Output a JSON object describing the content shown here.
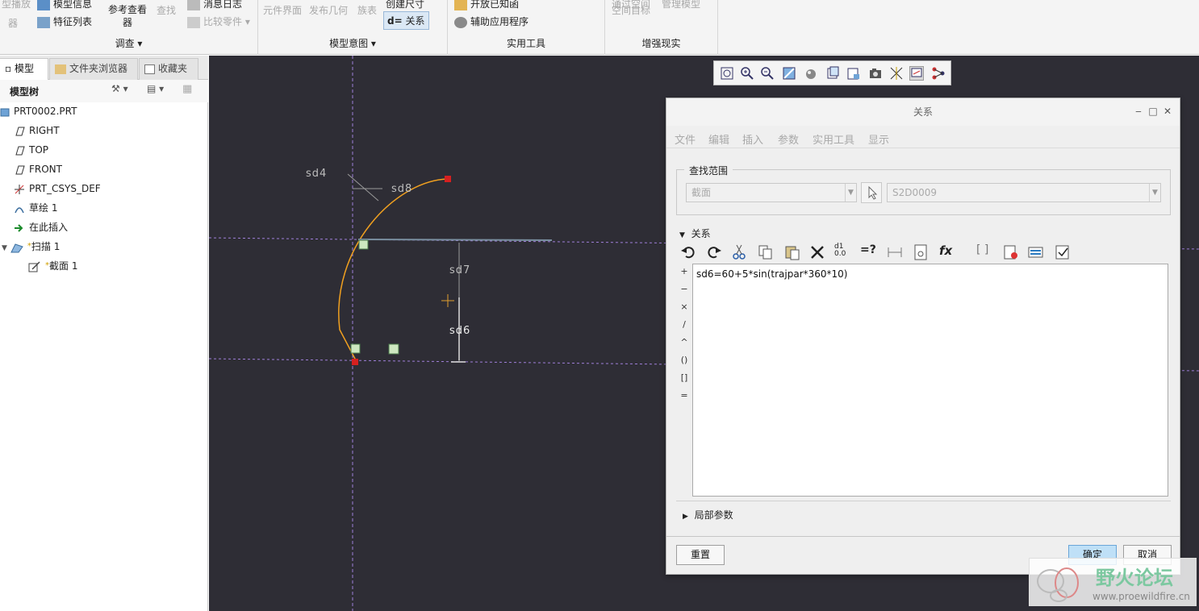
{
  "ribbon": {
    "row_top": {
      "g1": "型播放",
      "g2": "模型信息",
      "g4": "消息日志",
      "g5": "创建尺寸",
      "g6": "开放已知函",
      "g7": "通过空间",
      "g8": "管理模型"
    },
    "group1": {
      "item_a": "器",
      "item_b": "特征列表",
      "item_c": "参考查看",
      "item_c2": "器",
      "item_d": "查找",
      "item_e": "比较零件",
      "label": "调查"
    },
    "group2": {
      "item_a": "元件界面",
      "item_b": "发布几何",
      "item_c": "族表",
      "item_d": "关系",
      "label": "模型意图"
    },
    "group3": {
      "item_a": "辅助应用程序",
      "label": "实用工具"
    },
    "group4": {
      "item_a": "空间目标",
      "label": "增强现实"
    }
  },
  "left": {
    "tabs": [
      "模型树",
      "文件夹浏览器",
      "收藏夹"
    ],
    "tree_title": "模型树",
    "tree": [
      {
        "label": "PRT0002.PRT"
      },
      {
        "label": "RIGHT"
      },
      {
        "label": "TOP"
      },
      {
        "label": "FRONT"
      },
      {
        "label": "PRT_CSYS_DEF"
      },
      {
        "label": "草绘 1"
      },
      {
        "label": "在此插入"
      },
      {
        "label": "扫描 1"
      },
      {
        "label": "截面 1"
      }
    ]
  },
  "sketch": {
    "dims": [
      "sd4",
      "sd8",
      "sd7",
      "sd6"
    ]
  },
  "dialog": {
    "title": "关系",
    "menu": [
      "文件",
      "编辑",
      "插入",
      "参数",
      "实用工具",
      "显示"
    ],
    "scope_label": "查找范围",
    "scope_type": "截面",
    "scope_name": "S2D0009",
    "relations_label": "关系",
    "operators": [
      "+",
      "−",
      "×",
      "/",
      "^",
      "()",
      "[]",
      "="
    ],
    "relation_text": "sd6=60+5*sin(trajpar*360*10)",
    "local_params_label": "局部参数",
    "reset_button": "重置",
    "ok_button": "确定",
    "cancel_button": "取消"
  },
  "watermark": {
    "title": "野火论坛",
    "url": "www.proewildfire.cn"
  }
}
